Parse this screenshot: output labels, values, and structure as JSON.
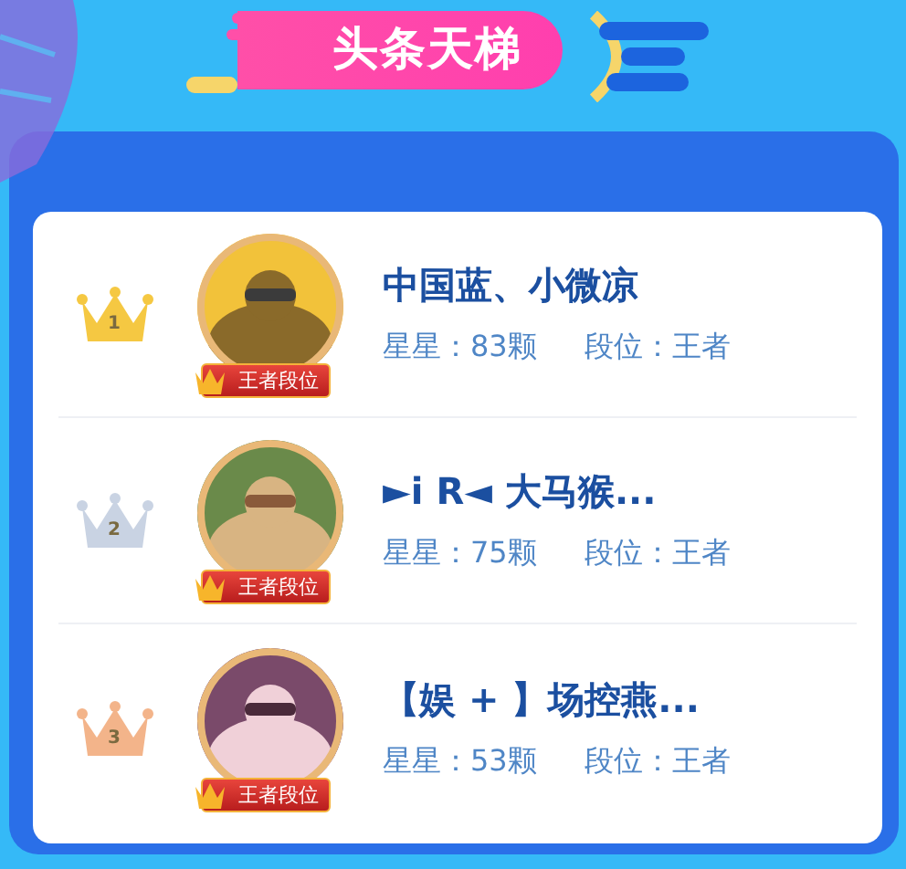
{
  "banner": {
    "title": "头条天梯"
  },
  "ranking": [
    {
      "rank": "1",
      "color": "#f5c842",
      "name": "中国蓝、小微凉",
      "badge": "王者段位",
      "stars": "星星：83颗",
      "tier": "段位：王者"
    },
    {
      "rank": "2",
      "color": "#c9d3e3",
      "name": "►i R◄ 大马猴...",
      "badge": "王者段位",
      "stars": "星星：75颗",
      "tier": "段位：王者"
    },
    {
      "rank": "3",
      "color": "#f3b48a",
      "name": "【娱 + 】场控燕...",
      "badge": "王者段位",
      "stars": "星星：53颗",
      "tier": "段位：王者"
    }
  ]
}
